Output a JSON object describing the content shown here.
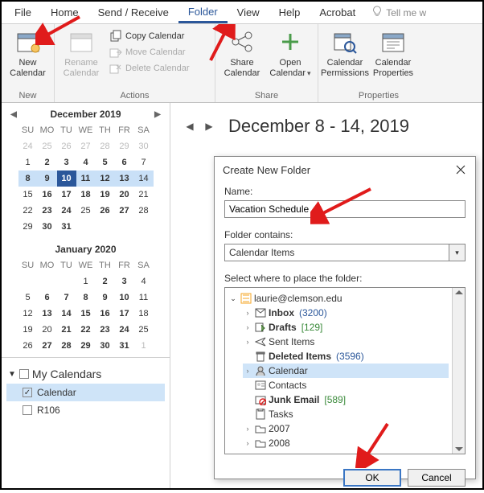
{
  "ribbon": {
    "tabs": {
      "file": "File",
      "home": "Home",
      "sendreceive": "Send / Receive",
      "folder": "Folder",
      "view": "View",
      "help": "Help",
      "acrobat": "Acrobat"
    },
    "tell_me": "Tell me w",
    "groups": {
      "new": {
        "label": "New",
        "new_calendar": "New\nCalendar"
      },
      "actions": {
        "label": "Actions",
        "rename": "Rename\nCalendar",
        "copy": "Copy Calendar",
        "move": "Move Calendar",
        "delete": "Delete Calendar"
      },
      "share": {
        "label": "Share",
        "share_cal": "Share\nCalendar",
        "open_cal": "Open\nCalendar"
      },
      "properties": {
        "label": "Properties",
        "permissions": "Calendar\nPermissions",
        "props": "Calendar\nProperties"
      }
    }
  },
  "sidebar": {
    "month1_title": "December 2019",
    "month2_title": "January 2020",
    "dow": [
      "SU",
      "MO",
      "TU",
      "WE",
      "TH",
      "FR",
      "SA"
    ],
    "dec_grid": [
      [
        {
          "n": 24,
          "d": 1
        },
        {
          "n": 25,
          "d": 1
        },
        {
          "n": 26,
          "d": 1
        },
        {
          "n": 27,
          "d": 1
        },
        {
          "n": 28,
          "d": 1
        },
        {
          "n": 29,
          "d": 1
        },
        {
          "n": 30,
          "d": 1
        }
      ],
      [
        {
          "n": 1
        },
        {
          "n": 2,
          "b": 1
        },
        {
          "n": 3,
          "b": 1
        },
        {
          "n": 4,
          "b": 1
        },
        {
          "n": 5,
          "b": 1
        },
        {
          "n": 6,
          "b": 1
        },
        {
          "n": 7
        }
      ],
      [
        {
          "n": 8,
          "h": 1,
          "b": 1
        },
        {
          "n": 9,
          "h": 1,
          "b": 1
        },
        {
          "n": 10,
          "t": 1,
          "b": 1
        },
        {
          "n": 11,
          "h": 1,
          "b": 1
        },
        {
          "n": 12,
          "h": 1,
          "b": 1
        },
        {
          "n": 13,
          "h": 1,
          "b": 1
        },
        {
          "n": 14,
          "h": 1
        }
      ],
      [
        {
          "n": 15
        },
        {
          "n": 16,
          "b": 1
        },
        {
          "n": 17,
          "b": 1
        },
        {
          "n": 18,
          "b": 1
        },
        {
          "n": 19,
          "b": 1
        },
        {
          "n": 20,
          "b": 1
        },
        {
          "n": 21
        }
      ],
      [
        {
          "n": 22
        },
        {
          "n": 23,
          "b": 1
        },
        {
          "n": 24,
          "b": 1
        },
        {
          "n": 25
        },
        {
          "n": 26,
          "b": 1
        },
        {
          "n": 27,
          "b": 1
        },
        {
          "n": 28
        }
      ],
      [
        {
          "n": 29
        },
        {
          "n": 30,
          "b": 1
        },
        {
          "n": 31,
          "b": 1
        },
        {
          "n": "",
          "d": 1
        },
        {
          "n": "",
          "d": 1
        },
        {
          "n": "",
          "d": 1
        },
        {
          "n": "",
          "d": 1
        }
      ]
    ],
    "jan_grid": [
      [
        {
          "n": "",
          "d": 1
        },
        {
          "n": "",
          "d": 1
        },
        {
          "n": "",
          "d": 1
        },
        {
          "n": 1
        },
        {
          "n": 2,
          "b": 1
        },
        {
          "n": 3,
          "b": 1
        },
        {
          "n": 4
        }
      ],
      [
        {
          "n": 5
        },
        {
          "n": 6,
          "b": 1
        },
        {
          "n": 7,
          "b": 1
        },
        {
          "n": 8,
          "b": 1
        },
        {
          "n": 9,
          "b": 1
        },
        {
          "n": 10,
          "b": 1
        },
        {
          "n": 11
        }
      ],
      [
        {
          "n": 12
        },
        {
          "n": 13,
          "b": 1
        },
        {
          "n": 14,
          "b": 1
        },
        {
          "n": 15,
          "b": 1
        },
        {
          "n": 16,
          "b": 1
        },
        {
          "n": 17,
          "b": 1
        },
        {
          "n": 18
        }
      ],
      [
        {
          "n": 19
        },
        {
          "n": 20
        },
        {
          "n": 21,
          "b": 1
        },
        {
          "n": 22,
          "b": 1
        },
        {
          "n": 23,
          "b": 1
        },
        {
          "n": 24,
          "b": 1
        },
        {
          "n": 25
        }
      ],
      [
        {
          "n": 26
        },
        {
          "n": 27,
          "b": 1
        },
        {
          "n": 28,
          "b": 1
        },
        {
          "n": 29,
          "b": 1
        },
        {
          "n": 30,
          "b": 1
        },
        {
          "n": 31,
          "b": 1
        },
        {
          "n": 1,
          "d": 1
        }
      ]
    ],
    "my_calendars_label": "My Calendars",
    "calendars": [
      {
        "name": "Calendar",
        "checked": true,
        "selected": true
      },
      {
        "name": "R106",
        "checked": false,
        "selected": false
      }
    ]
  },
  "content": {
    "week_title": "December 8 - 14, 2019"
  },
  "dialog": {
    "title": "Create New Folder",
    "name_label": "Name:",
    "name_value": "Vacation Schedule",
    "contains_label": "Folder contains:",
    "contains_value": "Calendar Items",
    "place_label": "Select where to place the folder:",
    "root": "laurie@clemson.edu",
    "folders": [
      {
        "icon": "inbox",
        "label": "Inbox",
        "count": "(3200)",
        "countClass": "blue",
        "bold": true,
        "toggle": true
      },
      {
        "icon": "drafts",
        "label": "Drafts",
        "count": "[129]",
        "countClass": "green",
        "bold": true,
        "toggle": true
      },
      {
        "icon": "sent",
        "label": "Sent Items",
        "toggle": true
      },
      {
        "icon": "deleted",
        "label": "Deleted Items",
        "count": "(3596)",
        "countClass": "blue",
        "bold": true
      },
      {
        "icon": "calendar",
        "label": "Calendar",
        "toggle": true,
        "selected": true
      },
      {
        "icon": "contacts",
        "label": "Contacts"
      },
      {
        "icon": "junk",
        "label": "Junk Email",
        "count": "[589]",
        "countClass": "green",
        "bold": true
      },
      {
        "icon": "tasks",
        "label": "Tasks"
      },
      {
        "icon": "folder",
        "label": "2007",
        "toggle": true
      },
      {
        "icon": "folder",
        "label": "2008",
        "toggle": true
      }
    ],
    "ok": "OK",
    "cancel": "Cancel"
  }
}
